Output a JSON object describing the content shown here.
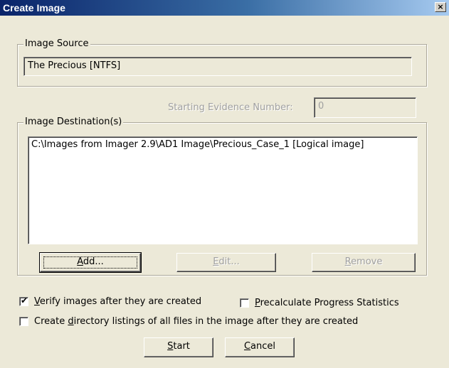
{
  "window": {
    "title": "Create Image",
    "close_glyph": "×"
  },
  "image_source": {
    "legend": "Image Source",
    "value": "The Precious [NTFS]"
  },
  "evidence": {
    "label": "Starting Evidence Number:",
    "value": "0"
  },
  "image_destinations": {
    "legend": "Image Destination(s)",
    "items": [
      "C:\\Images from Imager 2.9\\AD1 Image\\Precious_Case_1 [Logical image]"
    ]
  },
  "buttons": {
    "add": {
      "pre": "",
      "mnemonic": "A",
      "post": "dd..."
    },
    "edit": {
      "pre": "",
      "mnemonic": "E",
      "post": "dit..."
    },
    "remove": {
      "pre": "",
      "mnemonic": "R",
      "post": "emove"
    },
    "start": {
      "pre": "",
      "mnemonic": "S",
      "post": "tart"
    },
    "cancel": {
      "pre": "",
      "mnemonic": "C",
      "post": "ancel"
    }
  },
  "options": {
    "verify": {
      "pre": "",
      "mnemonic": "V",
      "post": "erify images after they are created",
      "checked": true
    },
    "precalculate": {
      "pre": "",
      "mnemonic": "P",
      "post": "recalculate Progress Statistics",
      "checked": false
    },
    "directory_listings": {
      "pre": "Create ",
      "mnemonic": "d",
      "post": "irectory listings of all files in the image after they are created",
      "checked": false
    }
  },
  "icons": {
    "checkmark": "✔"
  }
}
